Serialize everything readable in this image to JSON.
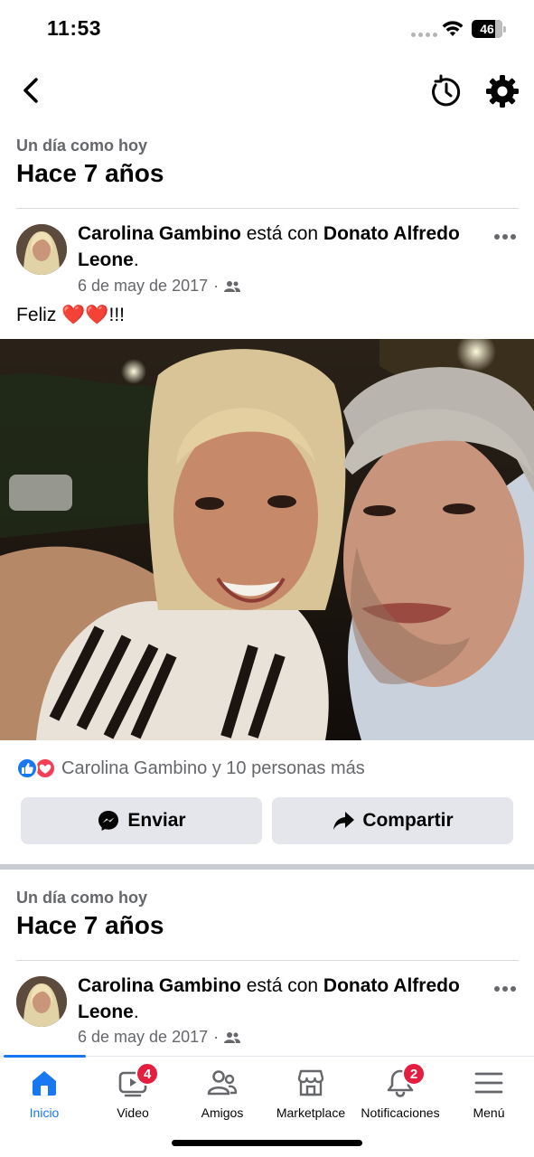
{
  "status_bar": {
    "time": "11:53",
    "battery": "46"
  },
  "memories": [
    {
      "subtitle": "Un día como hoy",
      "title": "Hace 7 años",
      "post": {
        "author": "Carolina Gambino",
        "connector": " está con ",
        "tagged": "Donato Alfredo Leone",
        "suffix": ".",
        "date": "6 de may de 2017",
        "meta_sep": "·",
        "audience_icon": "friends-icon",
        "text_prefix": "Feliz ",
        "text_emoji": "❤️❤️",
        "text_suffix": "!!!",
        "reactions_text": "Carolina Gambino y 10 personas más",
        "send_label": "Enviar",
        "share_label": "Compartir"
      }
    },
    {
      "subtitle": "Un día como hoy",
      "title": "Hace 7 años",
      "post": {
        "author": "Carolina Gambino",
        "connector": " está con ",
        "tagged": "Donato Alfredo Leone",
        "suffix": ".",
        "date": "6 de may de 2017",
        "meta_sep": "·"
      }
    }
  ],
  "tabs": [
    {
      "label": "Inicio",
      "icon": "home-icon",
      "active": true
    },
    {
      "label": "Video",
      "icon": "video-icon",
      "badge": "4"
    },
    {
      "label": "Amigos",
      "icon": "friends-icon"
    },
    {
      "label": "Marketplace",
      "icon": "marketplace-icon"
    },
    {
      "label": "Notificaciones",
      "icon": "bell-icon",
      "badge": "2"
    },
    {
      "label": "Menú",
      "icon": "menu-icon"
    }
  ],
  "colors": {
    "accent": "#1877f2",
    "badge": "#e41e3f",
    "secondary_text": "#65676b",
    "button_bg": "#e4e6eb"
  }
}
